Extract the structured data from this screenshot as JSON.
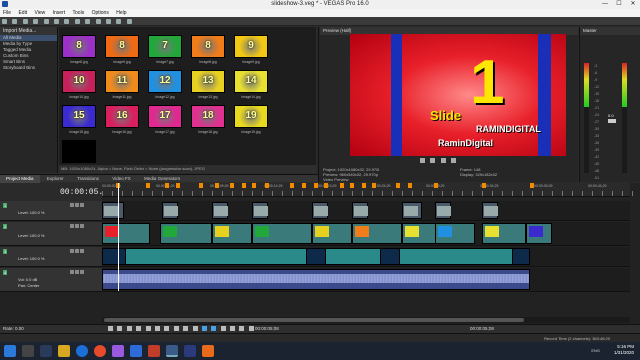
{
  "window": {
    "title": "slideshow-3.veg * - VEGAS Pro 16.0",
    "controls": [
      "—",
      "☐",
      "✕"
    ]
  },
  "menu": [
    "File",
    "Edit",
    "View",
    "Insert",
    "Tools",
    "Options",
    "Help"
  ],
  "explorer": {
    "header": "Import Media...",
    "items": [
      "All Media",
      "Media by Type",
      "Tagged Media",
      "Custom Bins",
      "Smart Bins",
      "Storyboard Bins"
    ]
  },
  "media_grid": {
    "thumbs": [
      {
        "num": "8",
        "caption": "Image8.jpg",
        "color": "#9b2fc8"
      },
      {
        "num": "8",
        "caption": "Image9.jpg",
        "color": "#f06a14"
      },
      {
        "num": "7",
        "caption": "Image7.jpg",
        "color": "#22a83a"
      },
      {
        "num": "8",
        "caption": "Image8.jpg",
        "color": "#f07c1a"
      },
      {
        "num": "9",
        "caption": "Image9.jpg",
        "color": "#f2c814"
      },
      {
        "num": "10",
        "caption": "Image10.jpg",
        "color": "#c8205a"
      },
      {
        "num": "11",
        "caption": "Image11.jpg",
        "color": "#f08c1c"
      },
      {
        "num": "12",
        "caption": "Image12.jpg",
        "color": "#2090e0"
      },
      {
        "num": "13",
        "caption": "Image13.jpg",
        "color": "#e8d020"
      },
      {
        "num": "14",
        "caption": "Image14.jpg",
        "color": "#e8e030"
      },
      {
        "num": "15",
        "caption": "Image15.jpg",
        "color": "#3a2ad0"
      },
      {
        "num": "16",
        "caption": "Image16.jpg",
        "color": "#d82060"
      },
      {
        "num": "17",
        "caption": "Image17.jpg",
        "color": "#e02890"
      },
      {
        "num": "18",
        "caption": "Image18.jpg",
        "color": "#e03090"
      },
      {
        "num": "19",
        "caption": "Image19.jpg",
        "color": "#e8d820"
      }
    ],
    "extra_caption": "Particle_01.mov",
    "status": "MB: 1920x1080x24, Alpha = None, Field Order = None (progressive scan), JPEG"
  },
  "left_tabs": [
    "Project Media",
    "Explorer",
    "Transitions",
    "Video FX",
    "Media Generators"
  ],
  "preview": {
    "header": "Preview (Half)",
    "big_number": "1",
    "slide_label": "Slide",
    "brand1": "RAMINDIGITAL",
    "brand2": "RaminDigital",
    "info": {
      "project": "Project:  1920x1080x32, 29.970i",
      "preview": "Preview:  960x540x32, 29.970p",
      "video_preview": "Video Preview",
      "frame": "Frame:  148",
      "display": "Display:  329x182x32"
    }
  },
  "master": {
    "header": "Master",
    "scale": [
      "-3",
      "-6",
      "-9",
      "-12",
      "-15",
      "-18",
      "-21",
      "-24",
      "-27",
      "-30",
      "-33",
      "-36",
      "-39",
      "-42",
      "-45",
      "-48",
      "-51",
      "-54",
      "-57"
    ],
    "value": "0.0",
    "bus_label": "Master Bus"
  },
  "timeline": {
    "timecode": "00:00:05.08",
    "ruler_labels": [
      "00:00:00;00",
      "00:00:04;29",
      "00:00:09;29",
      "00:00:14;29",
      "00:00:19;29",
      "00:00:24;29",
      "00:00:29;29",
      "00:00:34;29",
      "00:00:39;29",
      "00:00:44;29"
    ],
    "tracks": [
      {
        "num": "1",
        "level": "Level: 100.0 %"
      },
      {
        "num": "2",
        "level": "Level: 100.0 %"
      },
      {
        "num": "3",
        "level": "Level: 100.0 %"
      },
      {
        "num": "4",
        "vol": "Vol:     0.0 dB",
        "pan": "Pan:     Center"
      }
    ],
    "rate": "Rate: 0.00",
    "tc_display": "00:00:05;08",
    "tc_end": "00:00:05;08",
    "record_time": "Record Time (2 channels): 363:46:20"
  },
  "taskbar": {
    "time": "5:16 PM",
    "date": "1/31/2020",
    "lang": "ENG"
  },
  "colors": {
    "accent": "#f08a00",
    "preview_red": "#e8202a",
    "preview_blue": "#1a2fb8",
    "title_yellow": "#ffe600"
  }
}
